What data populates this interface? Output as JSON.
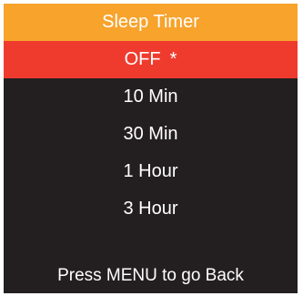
{
  "title": "Sleep Timer",
  "colors": {
    "title_bg": "#f7a32c",
    "selected_bg": "#ef3b2e",
    "screen_bg": "#231f20",
    "text": "#ffffff"
  },
  "menu": {
    "items": [
      {
        "label": "OFF",
        "marker": "*",
        "selected": true
      },
      {
        "label": "10 Min",
        "marker": "",
        "selected": false
      },
      {
        "label": "30 Min",
        "marker": "",
        "selected": false
      },
      {
        "label": "1 Hour",
        "marker": "",
        "selected": false
      },
      {
        "label": "3 Hour",
        "marker": "",
        "selected": false
      }
    ]
  },
  "footer_hint": "Press MENU to go Back"
}
